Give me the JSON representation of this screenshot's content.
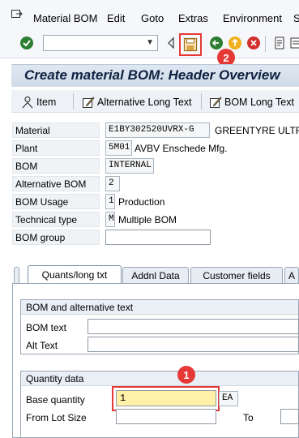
{
  "menu": {
    "items": [
      "Material BOM",
      "Edit",
      "Goto",
      "Extras",
      "Environment",
      "S"
    ]
  },
  "toolbar": {
    "command_value": "",
    "icons": [
      "enter-icon",
      "save-icon",
      "back-icon",
      "exit-icon",
      "cancel-icon",
      "print-icon",
      "find-icon"
    ]
  },
  "badges": {
    "save": "2",
    "base_quantity": "1"
  },
  "title": "Create material BOM: Header Overview",
  "app_toolbar": {
    "item": "Item",
    "alt_long_text": "Alternative Long Text",
    "bom_long_text": "BOM Long Text"
  },
  "form": {
    "material": {
      "label": "Material",
      "value": "E1BY302520UVRX-G",
      "desc": "GREENTYRE ULTR"
    },
    "plant": {
      "label": "Plant",
      "value": "5M01",
      "desc": "AVBV Enschede Mfg."
    },
    "bom": {
      "label": "BOM",
      "value": "INTERNAL"
    },
    "alt_bom": {
      "label": "Alternative BOM",
      "value": "2"
    },
    "bom_usage": {
      "label": "BOM Usage",
      "value": "1",
      "desc": "Production"
    },
    "technical_type": {
      "label": "Technical type",
      "value": "M",
      "desc": "Multiple BOM"
    },
    "bom_group": {
      "label": "BOM group",
      "value": ""
    }
  },
  "tabs": [
    "Quants/long txt",
    "Addnl Data",
    "Customer fields",
    "A"
  ],
  "group_text": {
    "title": "BOM and alternative text",
    "bom_text_label": "BOM text",
    "alt_text_label": "Alt Text"
  },
  "group_qty": {
    "title": "Quantity data",
    "base_qty_label": "Base quantity",
    "base_qty_value": "1",
    "unit": "EA",
    "from_lot_label": "From Lot Size",
    "to_label": "To"
  },
  "colors": {
    "highlight_red": "#e53935",
    "input_yellow": "#fff2a8"
  }
}
